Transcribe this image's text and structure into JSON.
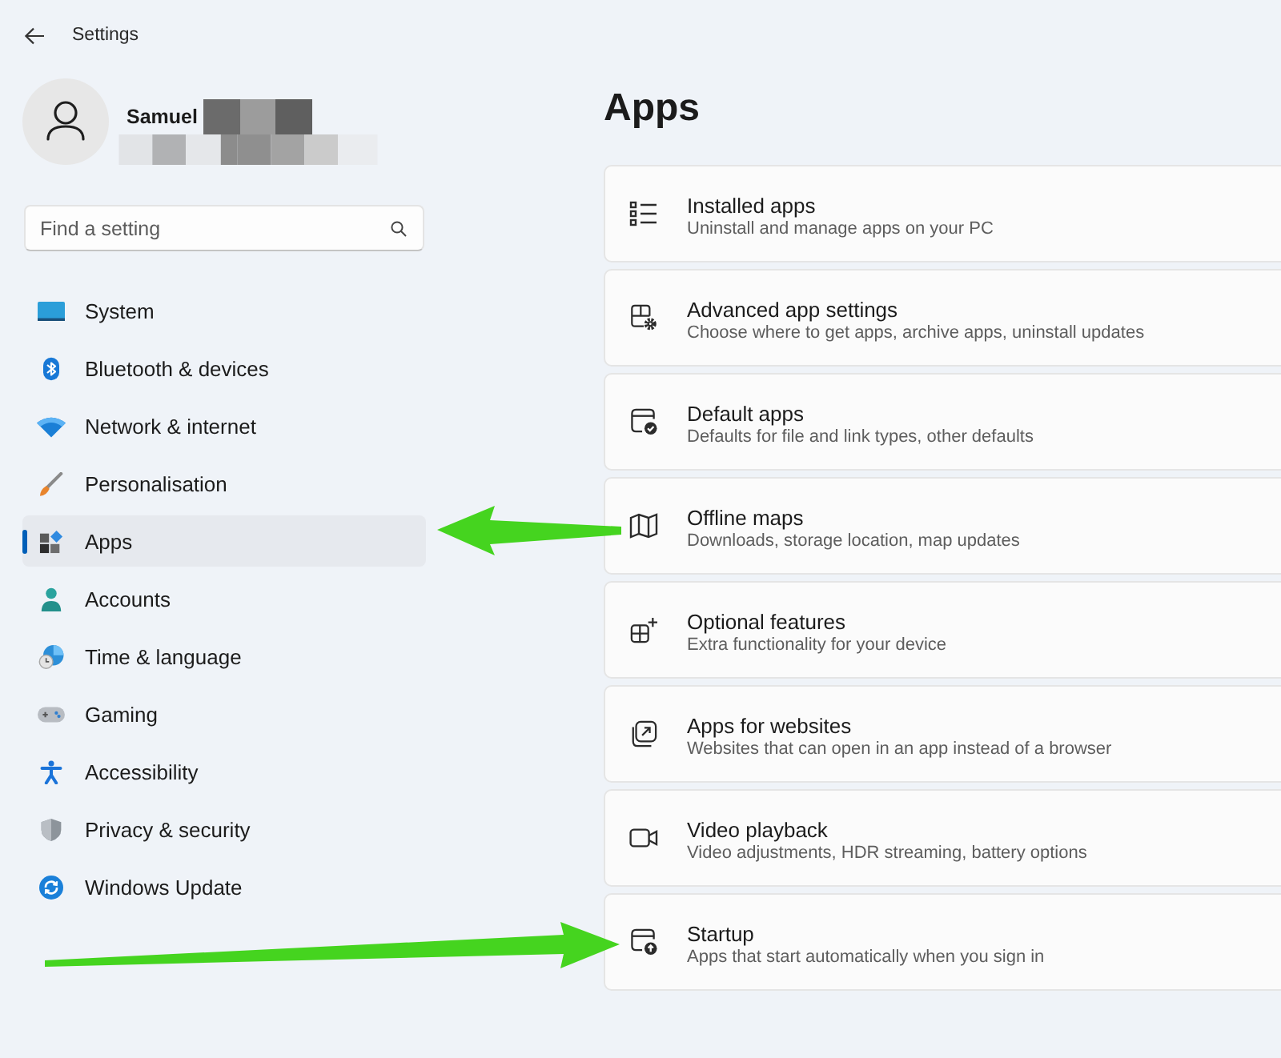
{
  "window": {
    "title": "Settings"
  },
  "profile": {
    "name": "Samuel"
  },
  "search": {
    "placeholder": "Find a setting"
  },
  "nav": [
    {
      "label": "System",
      "selected": false
    },
    {
      "label": "Bluetooth & devices",
      "selected": false
    },
    {
      "label": "Network & internet",
      "selected": false
    },
    {
      "label": "Personalisation",
      "selected": false
    },
    {
      "label": "Apps",
      "selected": true
    },
    {
      "label": "Accounts",
      "selected": false
    },
    {
      "label": "Time & language",
      "selected": false
    },
    {
      "label": "Gaming",
      "selected": false
    },
    {
      "label": "Accessibility",
      "selected": false
    },
    {
      "label": "Privacy & security",
      "selected": false
    },
    {
      "label": "Windows Update",
      "selected": false
    }
  ],
  "page": {
    "title": "Apps"
  },
  "cards": [
    {
      "title": "Installed apps",
      "subtitle": "Uninstall and manage apps on your PC"
    },
    {
      "title": "Advanced app settings",
      "subtitle": "Choose where to get apps, archive apps, uninstall updates"
    },
    {
      "title": "Default apps",
      "subtitle": "Defaults for file and link types, other defaults"
    },
    {
      "title": "Offline maps",
      "subtitle": "Downloads, storage location, map updates"
    },
    {
      "title": "Optional features",
      "subtitle": "Extra functionality for your device"
    },
    {
      "title": "Apps for websites",
      "subtitle": "Websites that can open in an app instead of a browser"
    },
    {
      "title": "Video playback",
      "subtitle": "Video adjustments, HDR streaming, battery options"
    },
    {
      "title": "Startup",
      "subtitle": "Apps that start automatically when you sign in"
    }
  ]
}
